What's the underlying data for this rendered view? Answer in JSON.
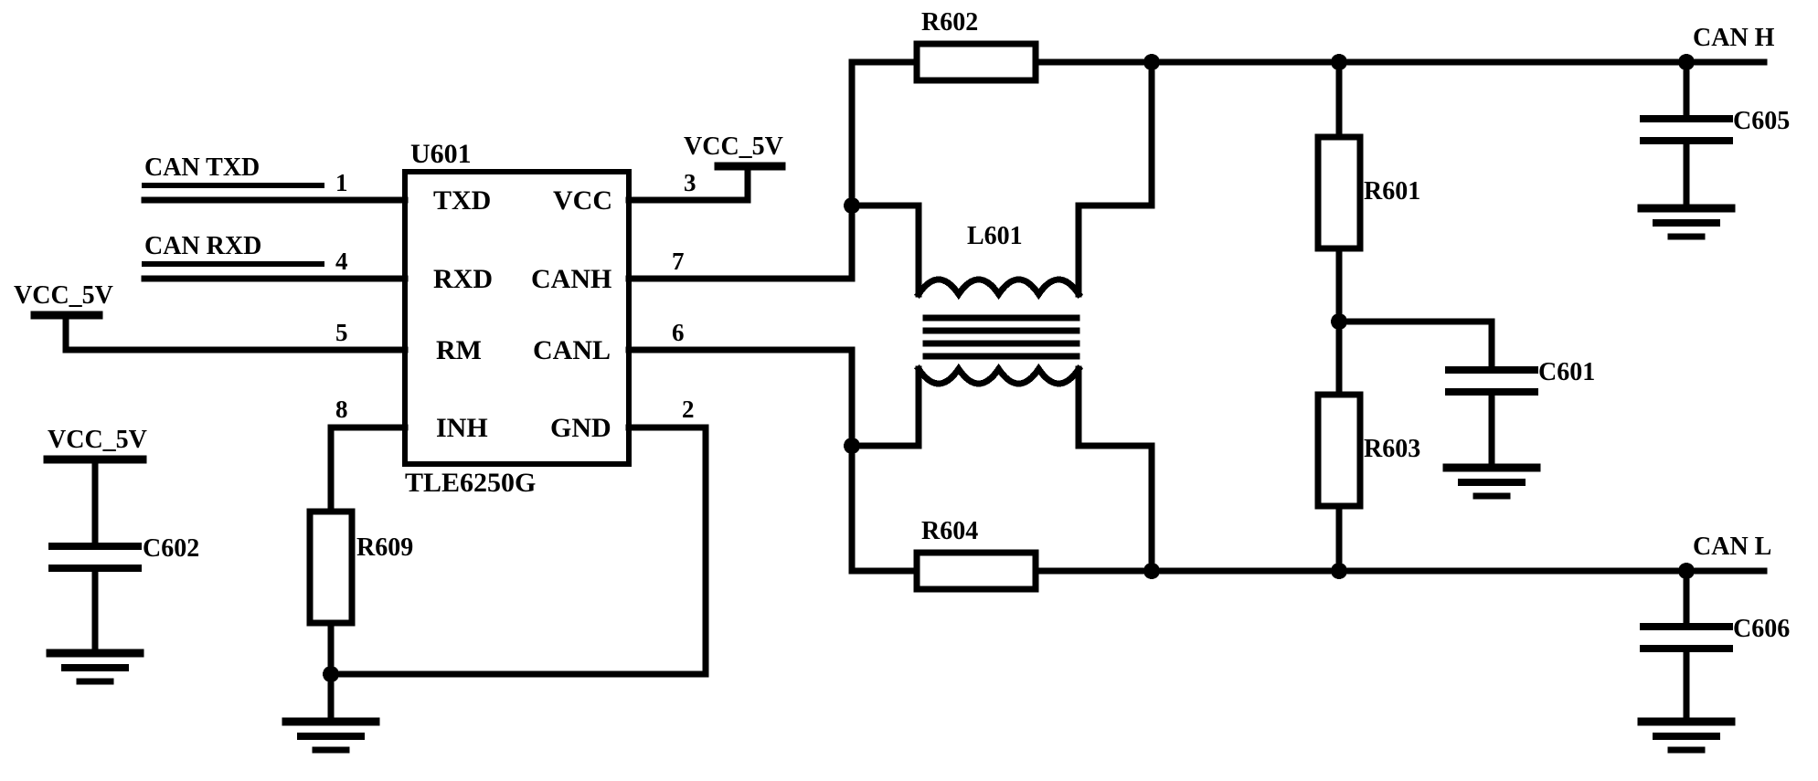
{
  "diagram": {
    "title": "CAN bus transceiver interface circuit",
    "type": "electronic-schematic",
    "stroke_color": "#000000",
    "background_color": "#ffffff"
  },
  "ic": {
    "refdes": "U601",
    "part_number": "TLE6250G",
    "pins_left": [
      {
        "number": "1",
        "name": "TXD"
      },
      {
        "number": "4",
        "name": "RXD"
      },
      {
        "number": "5",
        "name": "RM"
      },
      {
        "number": "8",
        "name": "INH"
      }
    ],
    "pins_right": [
      {
        "number": "3",
        "name": "VCC"
      },
      {
        "number": "7",
        "name": "CANH"
      },
      {
        "number": "6",
        "name": "CANL"
      },
      {
        "number": "2",
        "name": "GND"
      }
    ]
  },
  "nets": [
    {
      "name": "CAN TXD"
    },
    {
      "name": "CAN RXD"
    },
    {
      "name": "CAN H"
    },
    {
      "name": "CAN L"
    }
  ],
  "power_labels": [
    {
      "name": "VCC_5V"
    },
    {
      "name": "VCC_5V"
    },
    {
      "name": "VCC_5V"
    }
  ],
  "components": {
    "resistors": [
      {
        "refdes": "R602",
        "orientation": "horizontal"
      },
      {
        "refdes": "R604",
        "orientation": "horizontal"
      },
      {
        "refdes": "R601",
        "orientation": "vertical"
      },
      {
        "refdes": "R603",
        "orientation": "vertical"
      },
      {
        "refdes": "R609",
        "orientation": "vertical"
      }
    ],
    "capacitors": [
      {
        "refdes": "C605"
      },
      {
        "refdes": "C606"
      },
      {
        "refdes": "C601"
      },
      {
        "refdes": "C602"
      }
    ],
    "inductors": [
      {
        "refdes": "L601",
        "kind": "common-mode-choke"
      }
    ]
  },
  "labels": {
    "u601": "U601",
    "tle6250g": "TLE6250G",
    "txd": "TXD",
    "rxd": "RXD",
    "rm": "RM",
    "inh": "INH",
    "vcc": "VCC",
    "canh": "CANH",
    "canl": "CANL",
    "gnd": "GND",
    "pin1": "1",
    "pin4": "4",
    "pin5": "5",
    "pin8": "8",
    "pin3": "3",
    "pin7": "7",
    "pin6": "6",
    "pin2": "2",
    "can_txd": "CAN TXD",
    "can_rxd": "CAN RXD",
    "can_h": "CAN H",
    "can_l": "CAN L",
    "vcc_5v_left": "VCC_5V",
    "vcc_5v_top": "VCC_5V",
    "vcc_5v_bottom": "VCC_5V",
    "r601": "R601",
    "r602": "R602",
    "r603": "R603",
    "r604": "R604",
    "r609": "R609",
    "c601": "C601",
    "c602": "C602",
    "c605": "C605",
    "c606": "C606",
    "l601": "L601"
  }
}
